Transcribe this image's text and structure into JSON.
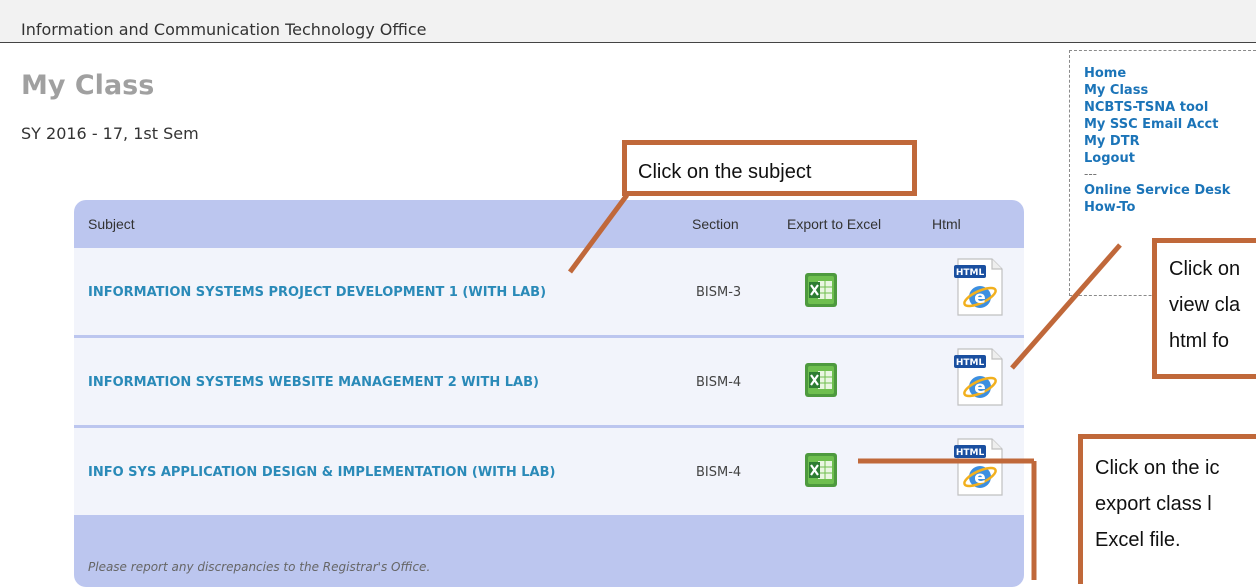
{
  "header": {
    "org": "Information and Communication Technology Office"
  },
  "page": {
    "title": "My Class",
    "term": "SY 2016 - 17, 1st Sem"
  },
  "nav": {
    "items": [
      "Home",
      "My Class",
      "NCBTS-TSNA tool",
      "My SSC Email Acct",
      "My DTR",
      "Logout"
    ],
    "separator": "---",
    "items2": [
      "Online Service Desk",
      "How-To"
    ]
  },
  "table": {
    "headers": {
      "subject": "Subject",
      "section": "Section",
      "export": "Export to Excel",
      "html": "Html"
    },
    "rows": [
      {
        "subject": "INFORMATION SYSTEMS PROJECT DEVELOPMENT 1 (WITH LAB)",
        "section": "BISM-3"
      },
      {
        "subject": "INFORMATION SYSTEMS WEBSITE MANAGEMENT 2 WITH LAB)",
        "section": "BISM-4"
      },
      {
        "subject": "INFO SYS APPLICATION DESIGN & IMPLEMENTATION (WITH LAB)",
        "section": "BISM-4"
      }
    ],
    "footer": "Please report any discrepancies to the Registrar's Office."
  },
  "icons": {
    "excel": "excel-icon",
    "html": "html-ie-icon"
  },
  "callouts": {
    "subject": "Click on the subject",
    "html": [
      "Click on",
      "view cla",
      "html fo"
    ],
    "excel": [
      "Click on the ic",
      "export class l",
      "Excel file."
    ]
  },
  "colors": {
    "accent": "#c0683a",
    "link": "#1b74b8",
    "table_bg": "#bcc6ef",
    "title": "#a0a0a0"
  }
}
